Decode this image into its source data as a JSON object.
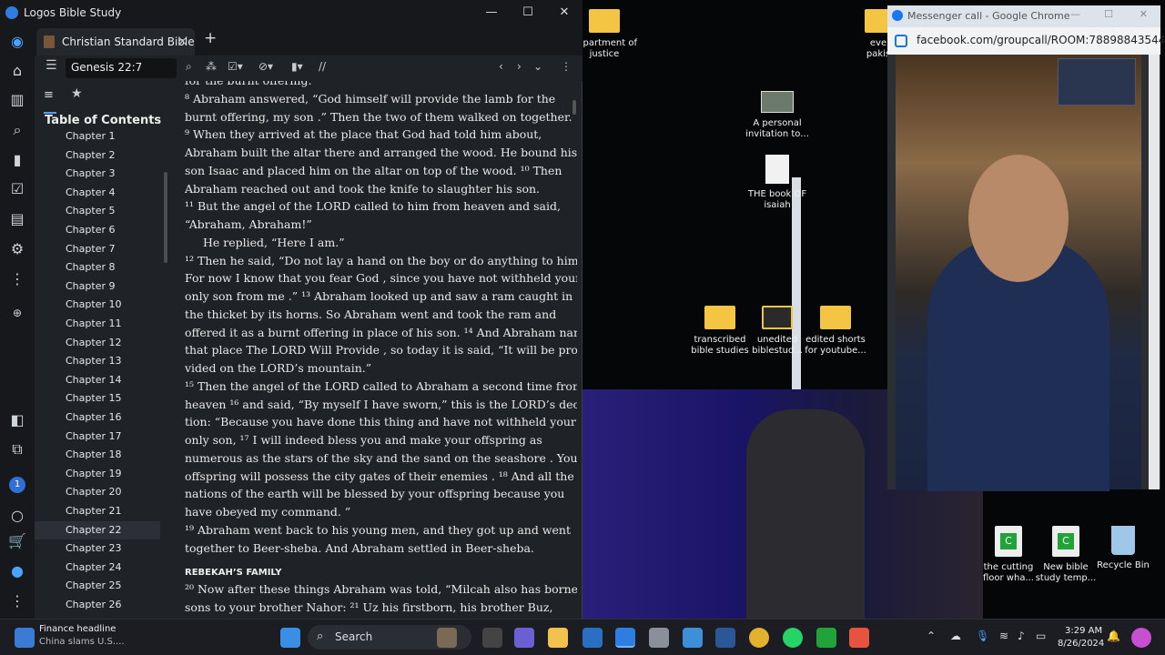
{
  "logos": {
    "window_title": "Logos Bible Study",
    "tab_label": "Christian Standard Bible",
    "reference": "Genesis 22:7",
    "toc_title": "Table of Contents",
    "chapters": [
      "Chapter 1",
      "Chapter 2",
      "Chapter 3",
      "Chapter 4",
      "Chapter 5",
      "Chapter 6",
      "Chapter 7",
      "Chapter 8",
      "Chapter 9",
      "Chapter 10",
      "Chapter 11",
      "Chapter 12",
      "Chapter 13",
      "Chapter 14",
      "Chapter 15",
      "Chapter 16",
      "Chapter 17",
      "Chapter 18",
      "Chapter 19",
      "Chapter 20",
      "Chapter 21",
      "Chapter 22",
      "Chapter 23",
      "Chapter 24",
      "Chapter 25",
      "Chapter 26"
    ],
    "selected_chapter": "Chapter 22",
    "lines": [
      "for the burnt offering.",
      "⁸ Abraham answered, “God himself will provide the lamb for the",
      "burnt offering, my son .” Then the two of them walked on together.",
      "⁹ When they arrived at the place that God had told him about,",
      "Abraham built the altar there and arranged the wood. He bound his",
      "son Isaac and placed him on the altar on top of the wood. ¹⁰ Then",
      "Abraham reached out and took the knife to slaughter his son.",
      "¹¹ But the angel of the LORD called to him from heaven and said,",
      "“Abraham, Abraham!”",
      "He replied, “Here I am.”",
      "¹² Then he said, “Do not lay a hand on the boy or do anything to him.",
      "For now I know that you fear God , since you have not withheld your",
      "only son from me .” ¹³ Abraham looked up and saw a ram caught in",
      "the thicket by its horns. So Abraham went and took the ram and",
      "offered it as a burnt offering in place of his son. ¹⁴ And Abraham named",
      "that place The LORD Will Provide , so today it is said, “It will be pro-",
      "vided on the LORD’s mountain.”",
      "¹⁵ Then the angel of the LORD called to Abraham a second time from",
      "heaven ¹⁶ and said, “By myself I have sworn,” this is the LORD’s declara-",
      "tion: “Because you have done this thing and have not withheld your",
      "only son, ¹⁷ I will indeed bless you and make your offspring as",
      "numerous as the stars of the sky and the sand on the seashore . Your",
      "offspring will possess the city gates of their enemies . ¹⁸ And all the",
      "nations of the earth will be blessed by your offspring because you",
      "have obeyed my command. ”",
      "¹⁹ Abraham went back to his young men, and they got up and went",
      "together to Beer-sheba. And Abraham settled in Beer-sheba.",
      "²⁰ Now after these things Abraham was told, “Milcah also has borne",
      "sons to your brother Nahor: ²¹ Uz his firstborn, his brother Buz,"
    ],
    "heading": "REBEKAH’S FAMILY"
  },
  "desktop": {
    "icons": [
      {
        "label": "department of justice"
      },
      {
        "label": "A personal invitation to..."
      },
      {
        "label": "THE book OF isaiah"
      },
      {
        "label": "transcribed bible studies"
      },
      {
        "label": "unedited biblestud..."
      },
      {
        "label": "edited shorts for youtube..."
      },
      {
        "label": "the cutting floor wha..."
      },
      {
        "label": "New bible study temp..."
      },
      {
        "label": "Recycle Bin"
      },
      {
        "label": "eve pakis"
      }
    ]
  },
  "chrome": {
    "title": "Messenger call - Google Chrome",
    "url": "facebook.com/groupcall/ROOM:78898843544..."
  },
  "taskbar": {
    "news_title": "Finance headline",
    "news_sub": "China slams U.S....",
    "search_placeholder": "Search",
    "time": "3:29 AM",
    "date": "8/26/2024",
    "badge": "1"
  }
}
